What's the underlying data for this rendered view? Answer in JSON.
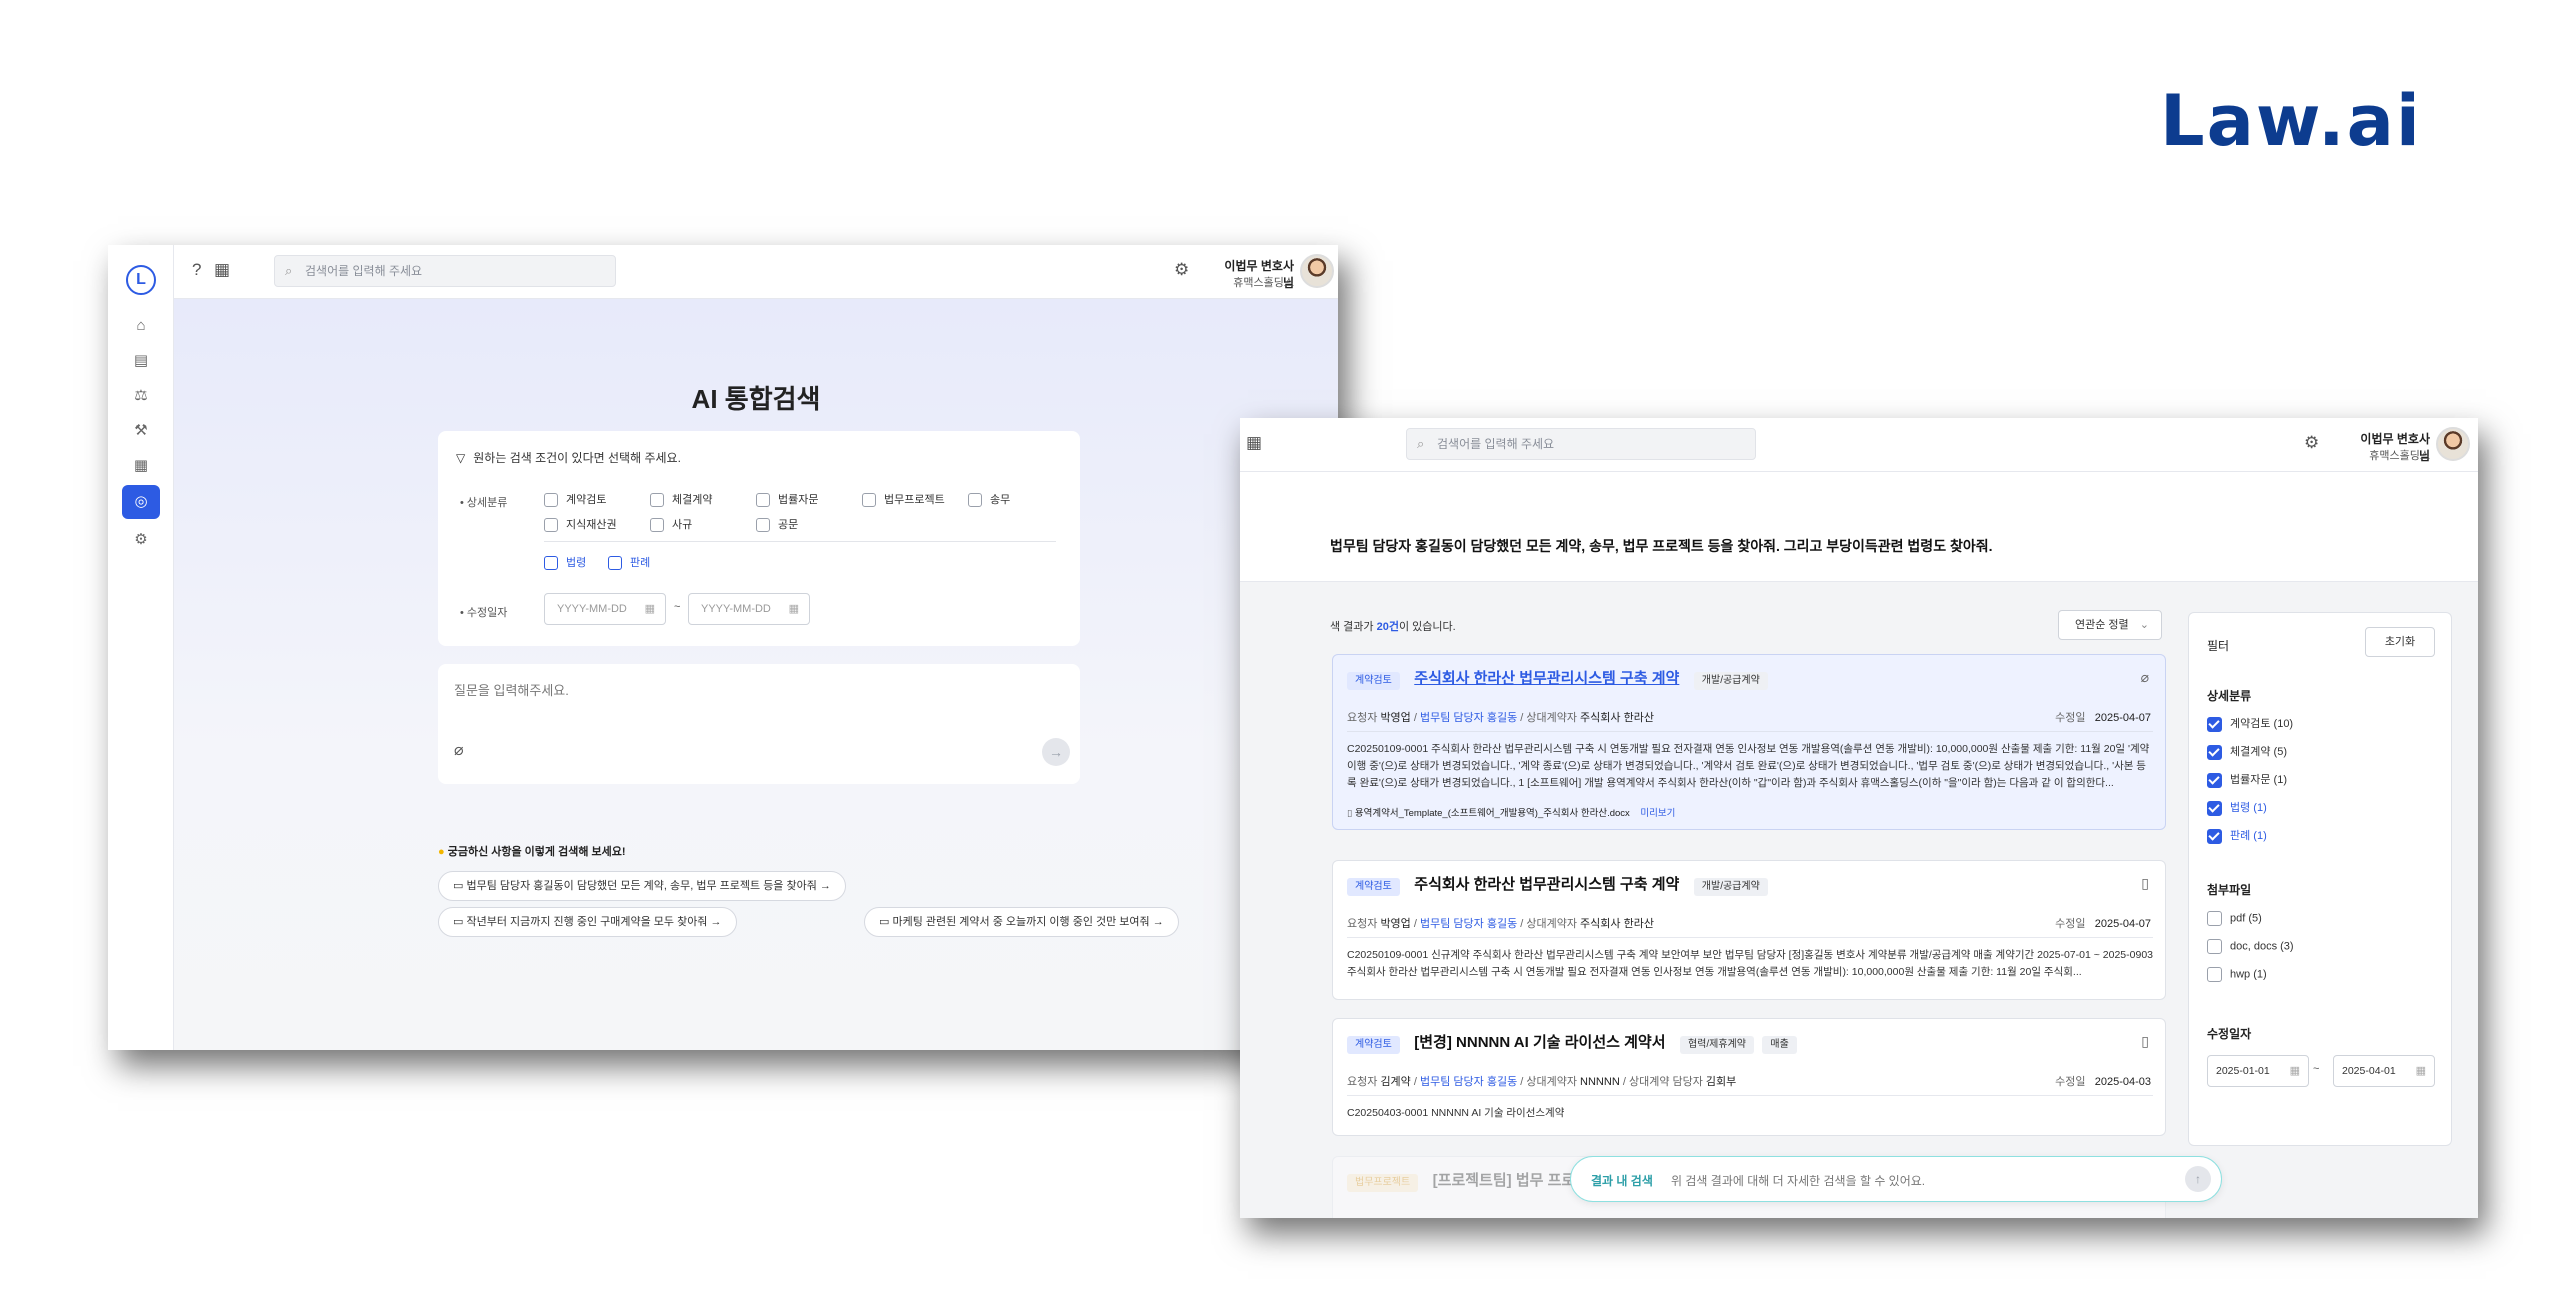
{
  "brand": {
    "logo": "Law.ai"
  },
  "user": {
    "name": "이법무 변호사님",
    "company": "휴맥스홀딩스"
  },
  "topbar": {
    "search_placeholder": "검색어를 입력해 주세요"
  },
  "search_page": {
    "title": "AI 통합검색",
    "filter_hint": "원하는 검색 조건이 있다면 선택해 주세요.",
    "category_label": "상세분류",
    "categories": [
      "계약검토",
      "체결계약",
      "법률자문",
      "법무프로젝트",
      "송무",
      "지식재산권",
      "사규",
      "공문"
    ],
    "extra_categories": [
      "법령",
      "판례"
    ],
    "date_label": "수정일자",
    "date_from_placeholder": "YYYY-MM-DD",
    "date_to_placeholder": "YYYY-MM-DD",
    "date_sep": "~",
    "question_placeholder": "질문을 입력해주세요.",
    "suggest_title": "궁금하신 사항을 이렇게 검색해 보세요!",
    "suggestions": [
      "법무팀 담당자 홍길동이 담당했던 모든 계약, 송무, 법무 프로젝트 등을 찾아줘",
      "작년부터 지금까지 진행 중인 구매계약을 모두 찾아줘",
      "마케팅 관련된 계약서 중 오늘까지 이행 중인 것만 보여줘"
    ]
  },
  "results_page": {
    "query": "법무팀 담당자 홍길동이 담당했던 모든 계약, 송무, 법무 프로젝트 등을 찾아줘. 그리고 부당이득관련 법령도 찾아줘.",
    "count_prefix": "색 결과가 ",
    "count": "20건",
    "count_suffix": "이 있습니다.",
    "sort": "연관순 정렬",
    "results": [
      {
        "tag": "계약검토",
        "title": "주식회사 한라산 법무관리시스템 구축 계약",
        "type": "개발/공급계약",
        "requester_label": "요청자",
        "requester": "박영업",
        "team": "법무팀 담당자",
        "manager": "홍길동",
        "party_label": "상대계약자",
        "party": "주식회사 한라산",
        "date_label": "수정일",
        "date": "2025-04-07",
        "body": "C20250109-0001 주식회사 한라산 법무관리시스템 구축 시 연동개발 필요 전자결재 연동 인사정보 연동 개발용역(솔루션 연동 개발비): 10,000,000원 산출물 제출 기한: 11월 20일 '계약 이행 중'(으)로 상태가 변경되었습니다., '계약 종료'(으)로 상태가 변경되었습니다., '계약서 검토 완료'(으)로 상태가 변경되었습니다., '법무 검토 중'(으)로 상태가 변경되었습니다., '사본 등록 완료'(으)로 상태가 변경되었습니다., 1 [소프트웨어] 개발 용역계약서 주식회사 한라산(이하 \"갑\"이라 함)과 주식회사 휴맥스홀딩스(이하 \"을\"이라 함)는 다음과 같 이 합의한다...",
        "attachment": "용역계약서_Template_(소프트웨어_개발용역)_주식회사 한라산.docx",
        "preview": "미리보기"
      },
      {
        "tag": "계약검토",
        "title": "주식회사 한라산 법무관리시스템 구축 계약",
        "type": "개발/공급계약",
        "requester_label": "요청자",
        "requester": "박영업",
        "team": "법무팀 담당자",
        "manager": "홍길동",
        "party_label": "상대계약자",
        "party": "주식회사 한라산",
        "date_label": "수정일",
        "date": "2025-04-07",
        "body": "C20250109-0001 신규계약 주식회사 한라산 법무관리시스템 구축 계약 보안여부 보안 법무팀 담당자 [정]홍길동 변호사 계약분류 개발/공급계약 매출 계약기간 2025-07-01 ~ 2025-0903주식회사 한라산 법무관리시스템 구축 시 연동개발 필요 전자결재 연동 인사정보 연동 개발용역(솔루션 연동 개발비): 10,000,000원 산출물 제출 기한: 11월 20일 주식회..."
      },
      {
        "tag": "계약검토",
        "title": "[변경] NNNNN AI 기술 라이선스 계약서",
        "type": "협력/제휴계약",
        "type2": "매출",
        "requester_label": "요청자",
        "requester": "김계약",
        "team": "법무팀 담당자",
        "manager": "홍길동",
        "party_label": "상대계약자",
        "party": "NNNNN",
        "party2_label": "상대계약 담당자",
        "party2": "김회부",
        "date_label": "수정일",
        "date": "2025-04-03",
        "body": "C20250403-0001 NNNNN AI 기술 라이선스계약"
      },
      {
        "tag": "법무프로젝트",
        "title": "[프로젝트팀] 법무 프로"
      }
    ],
    "filter": {
      "title": "필터",
      "reset": "초기화",
      "category_title": "상세분류",
      "categories": [
        {
          "label": "계약검토 (10)",
          "checked": true
        },
        {
          "label": "체결계약 (5)",
          "checked": true
        },
        {
          "label": "법률자문 (1)",
          "checked": true
        },
        {
          "label": "법령 (1)",
          "checked": true
        },
        {
          "label": "판례 (1)",
          "checked": true
        }
      ],
      "file_title": "첨부파일",
      "files": [
        "pdf (5)",
        "doc, docs (3)",
        "hwp (1)"
      ],
      "date_title": "수정일자",
      "date_from": "2025-01-01",
      "date_to": "2025-04-01",
      "date_sep": "~"
    },
    "inner_search": {
      "label": "결과 내 검색",
      "placeholder": "위 검색 결과에 대해 더 자세한 검색을 할 수 있어요."
    }
  }
}
